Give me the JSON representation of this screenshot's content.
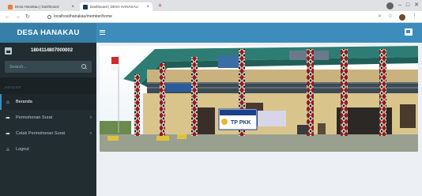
{
  "browser": {
    "tabs": [
      {
        "title": "Desa Hanakau | Dashboard",
        "active": false,
        "favicon_color": "#e8803a"
      },
      {
        "title": "Dashboard | DESA HANAKAU",
        "active": true,
        "favicon_color": "#1f3b57"
      }
    ],
    "new_tab_symbol": "+",
    "url": "localhost/hanakau/member/home",
    "window_controls": [
      "–",
      "□",
      "✕"
    ]
  },
  "sidebar": {
    "brand": "DESA HANAKAU",
    "user_name": "1804114807000002",
    "search_placeholder": "Search...",
    "section_header": "HEADER",
    "items": [
      {
        "label": "Beranda",
        "icon": "dashboard-icon",
        "glyph": "⌂",
        "has_chevron": false,
        "active": true
      },
      {
        "label": "Permohonan Surat",
        "icon": "share-icon",
        "glyph": "➦",
        "has_chevron": true,
        "chevron": "‹",
        "active": false
      },
      {
        "label": "Cetak Permohonan Surat",
        "icon": "share-icon",
        "glyph": "➦",
        "has_chevron": true,
        "chevron": "‹",
        "active": false
      },
      {
        "label": "Logout",
        "icon": "dashboard-icon",
        "glyph": "⌂",
        "has_chevron": false,
        "active": false
      }
    ]
  },
  "colors": {
    "brand_bg": "#367fa9",
    "navbar_bg": "#3c8dbc",
    "sidebar_bg": "#222d32",
    "content_bg": "#ecf0f5"
  },
  "banner": {
    "sign_text": "TP PKK",
    "description": "village office building photo"
  }
}
